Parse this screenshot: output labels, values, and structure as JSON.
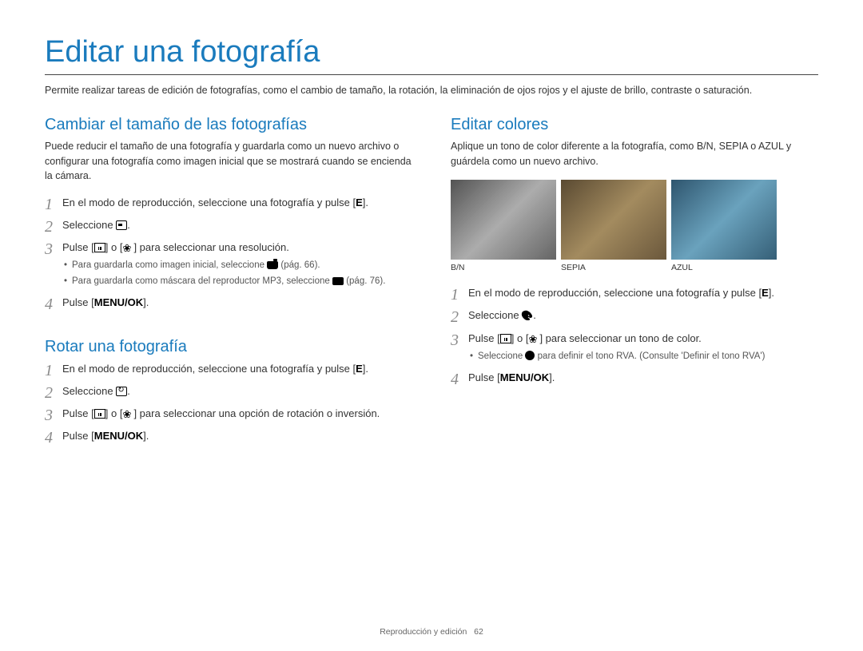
{
  "page_title": "Editar una fotografía",
  "intro": "Permite realizar tareas de edición de fotografías, como el cambio de tamaño, la rotación, la eliminación de ojos rojos y el ajuste de brillo, contraste o saturación.",
  "footer_section": "Reproducción y edición",
  "footer_page": "62",
  "resize": {
    "title": "Cambiar el tamaño de las fotografías",
    "intro": "Puede reducir el tamaño de una fotografía y guardarla como un nuevo archivo o configurar una fotografía como imagen inicial que se mostrará cuando se encienda la cámara.",
    "s1a": "En el modo de reproducción, seleccione una fotografía y pulse [",
    "s1b": "E",
    "s1c": "].",
    "s2a": "Seleccione ",
    "s2b": ".",
    "s3a": "Pulse [",
    "s3b": "] o [",
    "s3c": "] para seleccionar una resolución.",
    "sub1a": "Para guardarla como imagen inicial, seleccione ",
    "sub1b": " (pág. 66).",
    "sub2a": "Para guardarla como máscara del reproductor MP3, seleccione ",
    "sub2b": " (pág. 76).",
    "s4a": "Pulse [",
    "s4b": "MENU/OK",
    "s4c": "]."
  },
  "rotate": {
    "title": "Rotar una fotografía",
    "s1a": "En el modo de reproducción, seleccione una fotografía y pulse [",
    "s1b": "E",
    "s1c": "].",
    "s2a": "Seleccione ",
    "s2b": ".",
    "s3a": "Pulse [",
    "s3b": "] o [",
    "s3c": "] para seleccionar una opción de rotación o inversión.",
    "s4a": "Pulse [",
    "s4b": "MENU/OK",
    "s4c": "]."
  },
  "colors": {
    "title": "Editar colores",
    "intro": "Aplique un tono de color diferente a la fotografía, como B/N, SEPIA o AZUL y guárdela como un nuevo archivo.",
    "labels": {
      "bn": "B/N",
      "sepia": "SEPIA",
      "azul": "AZUL"
    },
    "s1a": "En el modo de reproducción, seleccione una fotografía y pulse [",
    "s1b": "E",
    "s1c": "].",
    "s2a": "Seleccione ",
    "s2b": ".",
    "s3a": "Pulse [",
    "s3b": "] o [",
    "s3c": "] para seleccionar un tono de color.",
    "sub1a": "Seleccione ",
    "sub1b": " para definir el tono RVA. (Consulte 'Definir el tono RVA')",
    "s4a": "Pulse [",
    "s4b": "MENU/OK",
    "s4c": "]."
  }
}
